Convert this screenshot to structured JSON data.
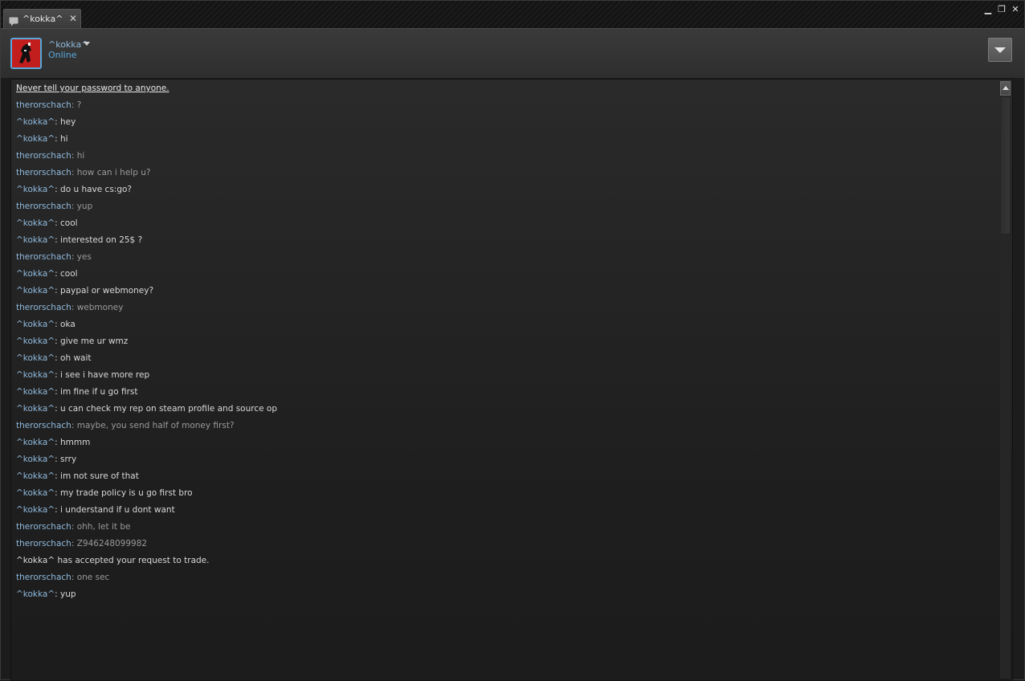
{
  "window": {
    "tab_title": "^kokka^",
    "tab_close": "✕",
    "minimize": "▁",
    "restore": "❐",
    "close": "✕"
  },
  "friend": {
    "name": "^kokka^",
    "status": "Online"
  },
  "chat": {
    "warning": "Never tell your password to anyone.",
    "messages": [
      {
        "sender": "therorschach",
        "text": "?",
        "who": "friend"
      },
      {
        "sender": "^kokka^",
        "text": "hey",
        "who": "self"
      },
      {
        "sender": "^kokka^",
        "text": "hi",
        "who": "self"
      },
      {
        "sender": "therorschach",
        "text": "hi",
        "who": "friend"
      },
      {
        "sender": "therorschach",
        "text": "how can i help u?",
        "who": "friend"
      },
      {
        "sender": "^kokka^",
        "text": "do u have cs:go?",
        "who": "self"
      },
      {
        "sender": "therorschach",
        "text": "yup",
        "who": "friend"
      },
      {
        "sender": "^kokka^",
        "text": "cool",
        "who": "self"
      },
      {
        "sender": "^kokka^",
        "text": "interested on 25$ ?",
        "who": "self"
      },
      {
        "sender": "therorschach",
        "text": "yes",
        "who": "friend"
      },
      {
        "sender": "^kokka^",
        "text": "cool",
        "who": "self"
      },
      {
        "sender": "^kokka^",
        "text": "paypal or webmoney?",
        "who": "self"
      },
      {
        "sender": "therorschach",
        "text": "webmoney",
        "who": "friend"
      },
      {
        "sender": "^kokka^",
        "text": "oka",
        "who": "self"
      },
      {
        "sender": "^kokka^",
        "text": "give me ur wmz",
        "who": "self"
      },
      {
        "sender": "^kokka^",
        "text": "oh wait",
        "who": "self"
      },
      {
        "sender": "^kokka^",
        "text": "i see i have more rep",
        "who": "self"
      },
      {
        "sender": "^kokka^",
        "text": "im fine if u go first",
        "who": "self"
      },
      {
        "sender": "^kokka^",
        "text": "u can check my rep on steam profile and source op",
        "who": "self"
      },
      {
        "sender": "therorschach",
        "text": "maybe, you send half of money first?",
        "who": "friend"
      },
      {
        "sender": "^kokka^",
        "text": "hmmm",
        "who": "self"
      },
      {
        "sender": "^kokka^",
        "text": "srry",
        "who": "self"
      },
      {
        "sender": "^kokka^",
        "text": "im not sure of that",
        "who": "self"
      },
      {
        "sender": "^kokka^",
        "text": "my trade policy is u go first bro",
        "who": "self"
      },
      {
        "sender": "^kokka^",
        "text": "i understand if u dont want",
        "who": "self"
      },
      {
        "sender": "therorschach",
        "text": "ohh, let it be",
        "who": "friend"
      },
      {
        "sender": "therorschach",
        "text": "Z946248099982",
        "who": "friend"
      },
      {
        "system": "^kokka^ has accepted your request to trade."
      },
      {
        "sender": "therorschach",
        "text": "one sec",
        "who": "friend"
      },
      {
        "sender": "^kokka^",
        "text": "yup",
        "who": "self"
      }
    ]
  }
}
